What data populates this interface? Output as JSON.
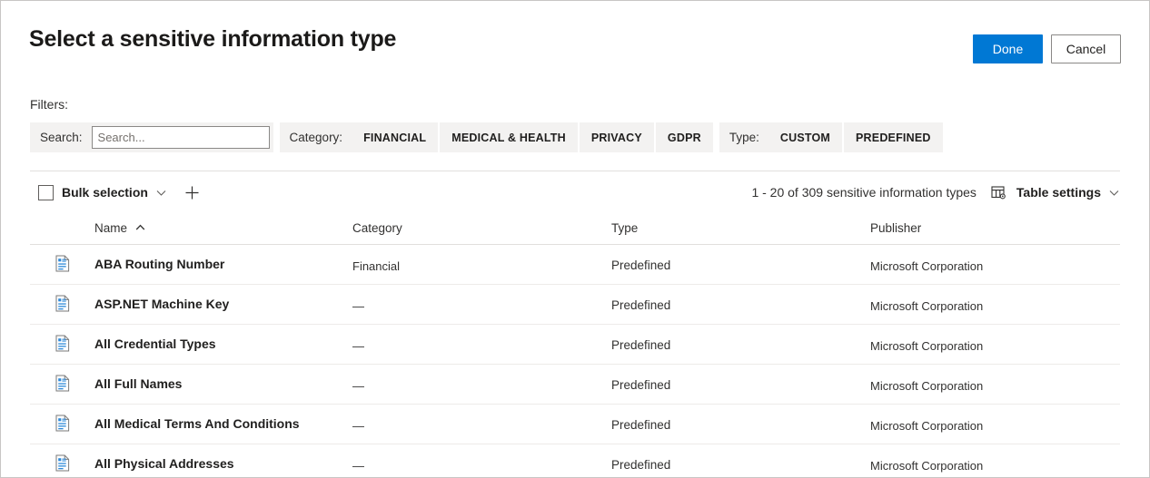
{
  "header": {
    "title": "Select a sensitive information type",
    "done_label": "Done",
    "cancel_label": "Cancel",
    "primary_color": "#0078d4"
  },
  "filters": {
    "label": "Filters:",
    "search_label": "Search:",
    "search_value": "",
    "search_placeholder": "Search...",
    "category_label": "Category:",
    "category_chips": [
      {
        "label": "FINANCIAL"
      },
      {
        "label": "MEDICAL & HEALTH"
      },
      {
        "label": "PRIVACY"
      },
      {
        "label": "GDPR"
      }
    ],
    "type_label": "Type:",
    "type_chips": [
      {
        "label": "CUSTOM"
      },
      {
        "label": "PREDEFINED"
      }
    ]
  },
  "commandbar": {
    "bulk_selection_label": "Bulk selection",
    "bulk_chevron_icon": "chevron-down-icon",
    "add_icon": "plus-icon",
    "result_count": "1 - 20 of 309 sensitive information types",
    "table_settings_label": "Table settings",
    "table_settings_icon": "table-settings-icon",
    "table_settings_chevron_icon": "chevron-down-icon"
  },
  "table": {
    "columns": [
      {
        "key": "name",
        "label": "Name",
        "sort": "asc"
      },
      {
        "key": "category",
        "label": "Category"
      },
      {
        "key": "type",
        "label": "Type"
      },
      {
        "key": "publisher",
        "label": "Publisher"
      }
    ],
    "rows": [
      {
        "icon": "document-icon",
        "name": "ABA Routing Number",
        "category": "Financial",
        "type": "Predefined",
        "publisher": "Microsoft Corporation"
      },
      {
        "icon": "document-icon",
        "name": "ASP.NET Machine Key",
        "category": "—",
        "type": "Predefined",
        "publisher": "Microsoft Corporation"
      },
      {
        "icon": "document-icon",
        "name": "All Credential Types",
        "category": "—",
        "type": "Predefined",
        "publisher": "Microsoft Corporation"
      },
      {
        "icon": "document-icon",
        "name": "All Full Names",
        "category": "—",
        "type": "Predefined",
        "publisher": "Microsoft Corporation"
      },
      {
        "icon": "document-icon",
        "name": "All Medical Terms And Conditions",
        "category": "—",
        "type": "Predefined",
        "publisher": "Microsoft Corporation"
      },
      {
        "icon": "document-icon",
        "name": "All Physical Addresses",
        "category": "—",
        "type": "Predefined",
        "publisher": "Microsoft Corporation"
      }
    ]
  }
}
